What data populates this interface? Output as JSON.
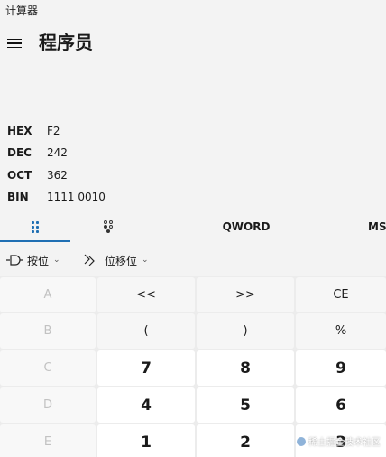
{
  "window": {
    "title": "计算器"
  },
  "header": {
    "mode_title": "程序员"
  },
  "radix": [
    {
      "label": "HEX",
      "value": "F2"
    },
    {
      "label": "DEC",
      "value": "242"
    },
    {
      "label": "OCT",
      "value": "362"
    },
    {
      "label": "BIN",
      "value": "1111 0010"
    }
  ],
  "tabs": {
    "word_size": "QWORD",
    "memory": "MS"
  },
  "ops": {
    "bitwise_label": "按位",
    "bitshift_label": "位移位"
  },
  "keys": {
    "row0": [
      "A",
      "<<",
      ">>",
      "CE"
    ],
    "row1": [
      "B",
      "(",
      ")",
      "%"
    ],
    "row2": [
      "C",
      "7",
      "8",
      "9"
    ],
    "row3": [
      "D",
      "4",
      "5",
      "6"
    ],
    "row4": [
      "E",
      "1",
      "2",
      "3"
    ]
  },
  "watermark": "稀土掘金技术社区",
  "colors": {
    "accent": "#1f6fb3",
    "background": "#f3f3f3"
  }
}
